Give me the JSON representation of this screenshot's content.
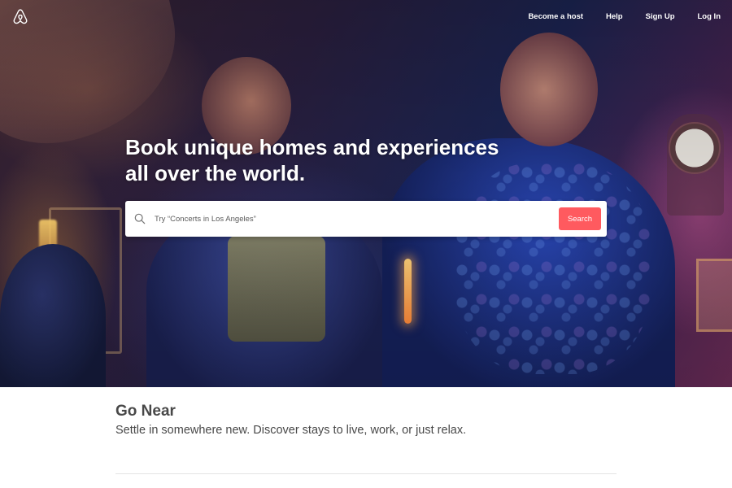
{
  "brand": {
    "logo_icon": "airbnb-logo-icon",
    "accent_color": "#ff5a5f"
  },
  "nav": {
    "items": [
      {
        "label": "Become a host"
      },
      {
        "label": "Help"
      },
      {
        "label": "Sign Up"
      },
      {
        "label": "Log In"
      }
    ]
  },
  "hero": {
    "headline_line1": "Book unique homes and experiences",
    "headline_line2": "all over the world."
  },
  "search": {
    "icon": "search-icon",
    "placeholder": "Try “Concerts in Los Angeles”",
    "button_label": "Search"
  },
  "section": {
    "title": "Go Near",
    "subtitle": "Settle in somewhere new. Discover stays to live, work, or just relax."
  }
}
